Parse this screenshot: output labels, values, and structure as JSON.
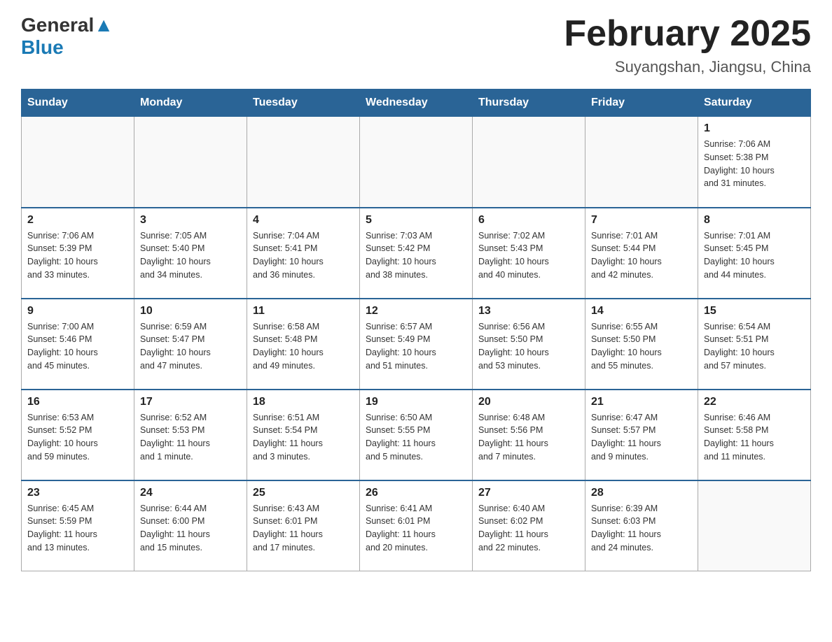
{
  "header": {
    "logo_general": "General",
    "logo_blue": "Blue",
    "title": "February 2025",
    "subtitle": "Suyangshan, Jiangsu, China"
  },
  "days_of_week": [
    "Sunday",
    "Monday",
    "Tuesday",
    "Wednesday",
    "Thursday",
    "Friday",
    "Saturday"
  ],
  "weeks": [
    [
      {
        "day": "",
        "info": ""
      },
      {
        "day": "",
        "info": ""
      },
      {
        "day": "",
        "info": ""
      },
      {
        "day": "",
        "info": ""
      },
      {
        "day": "",
        "info": ""
      },
      {
        "day": "",
        "info": ""
      },
      {
        "day": "1",
        "info": "Sunrise: 7:06 AM\nSunset: 5:38 PM\nDaylight: 10 hours\nand 31 minutes."
      }
    ],
    [
      {
        "day": "2",
        "info": "Sunrise: 7:06 AM\nSunset: 5:39 PM\nDaylight: 10 hours\nand 33 minutes."
      },
      {
        "day": "3",
        "info": "Sunrise: 7:05 AM\nSunset: 5:40 PM\nDaylight: 10 hours\nand 34 minutes."
      },
      {
        "day": "4",
        "info": "Sunrise: 7:04 AM\nSunset: 5:41 PM\nDaylight: 10 hours\nand 36 minutes."
      },
      {
        "day": "5",
        "info": "Sunrise: 7:03 AM\nSunset: 5:42 PM\nDaylight: 10 hours\nand 38 minutes."
      },
      {
        "day": "6",
        "info": "Sunrise: 7:02 AM\nSunset: 5:43 PM\nDaylight: 10 hours\nand 40 minutes."
      },
      {
        "day": "7",
        "info": "Sunrise: 7:01 AM\nSunset: 5:44 PM\nDaylight: 10 hours\nand 42 minutes."
      },
      {
        "day": "8",
        "info": "Sunrise: 7:01 AM\nSunset: 5:45 PM\nDaylight: 10 hours\nand 44 minutes."
      }
    ],
    [
      {
        "day": "9",
        "info": "Sunrise: 7:00 AM\nSunset: 5:46 PM\nDaylight: 10 hours\nand 45 minutes."
      },
      {
        "day": "10",
        "info": "Sunrise: 6:59 AM\nSunset: 5:47 PM\nDaylight: 10 hours\nand 47 minutes."
      },
      {
        "day": "11",
        "info": "Sunrise: 6:58 AM\nSunset: 5:48 PM\nDaylight: 10 hours\nand 49 minutes."
      },
      {
        "day": "12",
        "info": "Sunrise: 6:57 AM\nSunset: 5:49 PM\nDaylight: 10 hours\nand 51 minutes."
      },
      {
        "day": "13",
        "info": "Sunrise: 6:56 AM\nSunset: 5:50 PM\nDaylight: 10 hours\nand 53 minutes."
      },
      {
        "day": "14",
        "info": "Sunrise: 6:55 AM\nSunset: 5:50 PM\nDaylight: 10 hours\nand 55 minutes."
      },
      {
        "day": "15",
        "info": "Sunrise: 6:54 AM\nSunset: 5:51 PM\nDaylight: 10 hours\nand 57 minutes."
      }
    ],
    [
      {
        "day": "16",
        "info": "Sunrise: 6:53 AM\nSunset: 5:52 PM\nDaylight: 10 hours\nand 59 minutes."
      },
      {
        "day": "17",
        "info": "Sunrise: 6:52 AM\nSunset: 5:53 PM\nDaylight: 11 hours\nand 1 minute."
      },
      {
        "day": "18",
        "info": "Sunrise: 6:51 AM\nSunset: 5:54 PM\nDaylight: 11 hours\nand 3 minutes."
      },
      {
        "day": "19",
        "info": "Sunrise: 6:50 AM\nSunset: 5:55 PM\nDaylight: 11 hours\nand 5 minutes."
      },
      {
        "day": "20",
        "info": "Sunrise: 6:48 AM\nSunset: 5:56 PM\nDaylight: 11 hours\nand 7 minutes."
      },
      {
        "day": "21",
        "info": "Sunrise: 6:47 AM\nSunset: 5:57 PM\nDaylight: 11 hours\nand 9 minutes."
      },
      {
        "day": "22",
        "info": "Sunrise: 6:46 AM\nSunset: 5:58 PM\nDaylight: 11 hours\nand 11 minutes."
      }
    ],
    [
      {
        "day": "23",
        "info": "Sunrise: 6:45 AM\nSunset: 5:59 PM\nDaylight: 11 hours\nand 13 minutes."
      },
      {
        "day": "24",
        "info": "Sunrise: 6:44 AM\nSunset: 6:00 PM\nDaylight: 11 hours\nand 15 minutes."
      },
      {
        "day": "25",
        "info": "Sunrise: 6:43 AM\nSunset: 6:01 PM\nDaylight: 11 hours\nand 17 minutes."
      },
      {
        "day": "26",
        "info": "Sunrise: 6:41 AM\nSunset: 6:01 PM\nDaylight: 11 hours\nand 20 minutes."
      },
      {
        "day": "27",
        "info": "Sunrise: 6:40 AM\nSunset: 6:02 PM\nDaylight: 11 hours\nand 22 minutes."
      },
      {
        "day": "28",
        "info": "Sunrise: 6:39 AM\nSunset: 6:03 PM\nDaylight: 11 hours\nand 24 minutes."
      },
      {
        "day": "",
        "info": ""
      }
    ]
  ]
}
